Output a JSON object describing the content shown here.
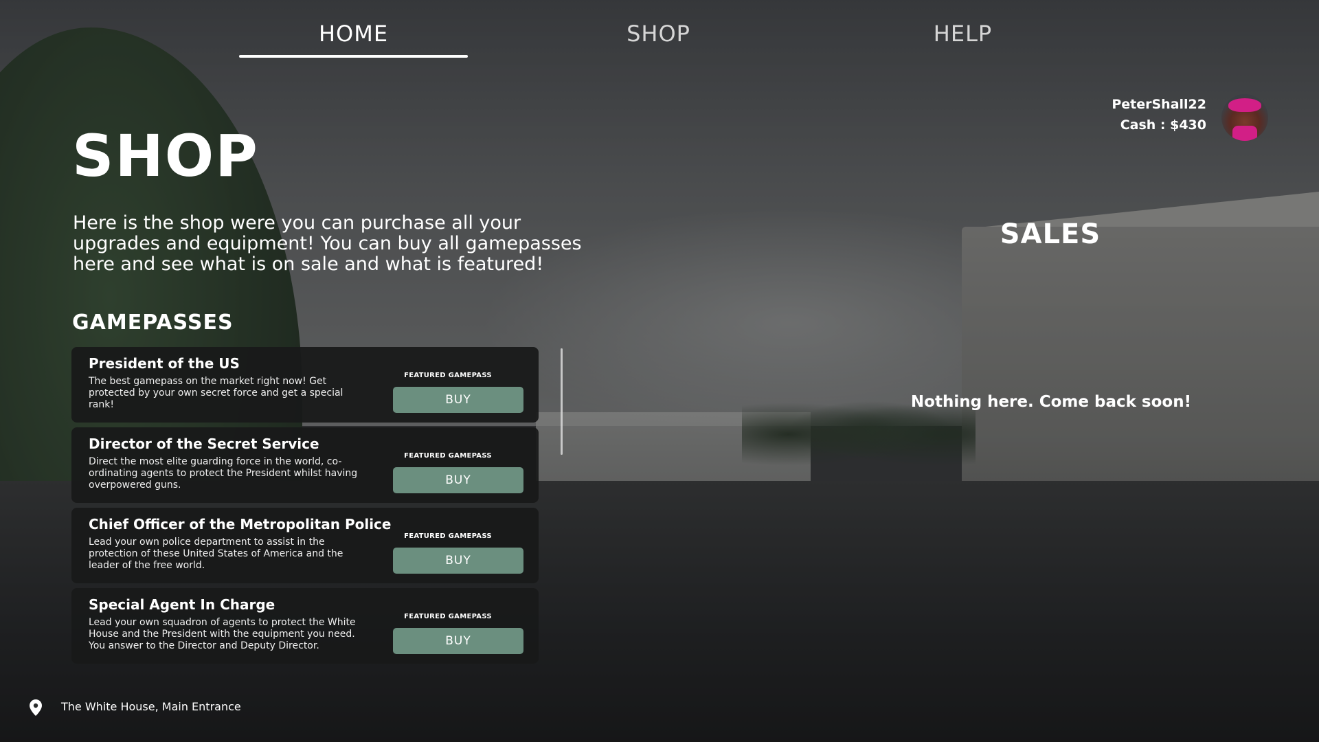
{
  "nav": {
    "tabs": [
      {
        "label": "HOME",
        "active": true
      },
      {
        "label": "SHOP",
        "active": false
      },
      {
        "label": "HELP",
        "active": false
      }
    ]
  },
  "user": {
    "name": "PeterShall22",
    "cash": "Cash : $430"
  },
  "page": {
    "title": "SHOP",
    "intro": "Here is the shop were you can purchase all your upgrades and equipment! You can buy all gamepasses here and see what is on sale and what is featured!"
  },
  "gamepasses": {
    "heading": "GAMEPASSES",
    "items": [
      {
        "title": "President of the US",
        "description": "The best gamepass on the market right now! Get protected by your own secret force and get a special rank!",
        "tag": "FEATURED GAMEPASS",
        "button": "BUY"
      },
      {
        "title": "Director of the Secret Service",
        "description": "Direct the most elite guarding force in the world, co-ordinating agents to protect the President whilst having overpowered guns.",
        "tag": "FEATURED GAMEPASS",
        "button": "BUY"
      },
      {
        "title": "Chief Officer of the Metropolitan Police",
        "description": "Lead your own police department to assist in the protection of these United States of America and the leader of the free world.",
        "tag": "FEATURED GAMEPASS",
        "button": "BUY"
      },
      {
        "title": "Special Agent In Charge",
        "description": "Lead your own squadron of agents to protect the White House and the President with the equipment you need. You answer to the Director and Deputy Director.",
        "tag": "FEATURED GAMEPASS",
        "button": "BUY"
      }
    ]
  },
  "sales": {
    "heading": "SALES",
    "empty_message": "Nothing here. Come back soon!"
  },
  "location": {
    "icon": "map-pin-icon",
    "text": "The White House, Main Entrance"
  },
  "colors": {
    "buy_button": "#6b8f7f",
    "card_bg": "#18191a",
    "active_underline": "#ffffff"
  }
}
